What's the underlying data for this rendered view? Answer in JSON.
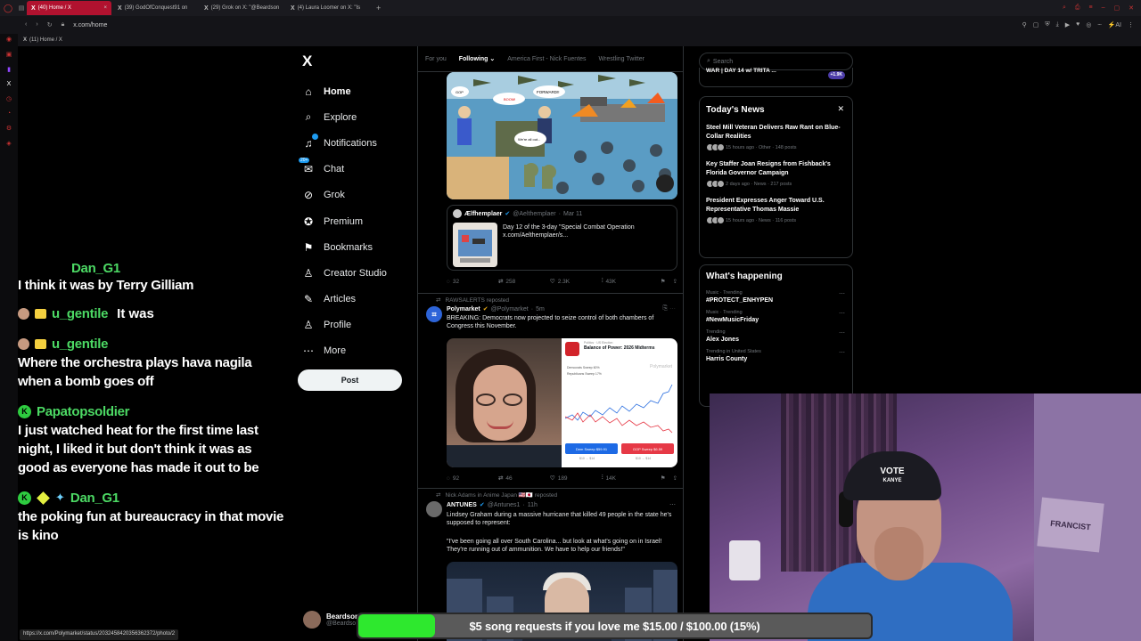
{
  "browser": {
    "tabs": [
      {
        "label": "(40) Home / X",
        "active": true
      },
      {
        "label": "(39) GodOfConquest91 on",
        "active": false
      },
      {
        "label": "(29) Grok on X: \"@Beardson",
        "active": false
      },
      {
        "label": "(4) Laura Loomer on X: \"Is",
        "active": false
      }
    ],
    "url": "x.com/home",
    "bookmark": "(11) Home / X",
    "status_url": "https://x.com/Polymarket/status/2032458420356362372/photo/2"
  },
  "chat": [
    {
      "user": "Dan_G1",
      "msg": "I think it was by Terry Gilliam",
      "cut": true
    },
    {
      "user": "u_gentile",
      "msg": "It was",
      "inline": true
    },
    {
      "user": "u_gentile",
      "msg": "Where the orchestra plays hava nagila when a bomb goes off"
    },
    {
      "user": "Papatopsoldier",
      "msg": "I just watched heat for the first time last night, I liked it but don't think it was as good as everyone has made it out to be"
    },
    {
      "user": "Dan_G1",
      "msg": "the poking fun at bureaucracy in that movie is kino"
    }
  ],
  "nav": {
    "logo": "X",
    "items": [
      {
        "label": "Home",
        "icon": "home-icon",
        "glyph": "⌂"
      },
      {
        "label": "Explore",
        "icon": "search-icon",
        "glyph": "⌕"
      },
      {
        "label": "Notifications",
        "icon": "bell-icon",
        "glyph": "♫"
      },
      {
        "label": "Chat",
        "icon": "chat-icon",
        "glyph": "✉"
      },
      {
        "label": "Grok",
        "icon": "grok-icon",
        "glyph": "⊘"
      },
      {
        "label": "Premium",
        "icon": "premium-icon",
        "glyph": "✪"
      },
      {
        "label": "Bookmarks",
        "icon": "bookmark-icon",
        "glyph": "⚑"
      },
      {
        "label": "Creator Studio",
        "icon": "creator-icon",
        "glyph": "♙"
      },
      {
        "label": "Articles",
        "icon": "articles-icon",
        "glyph": "✎"
      },
      {
        "label": "Profile",
        "icon": "profile-icon",
        "glyph": "♙"
      },
      {
        "label": "More",
        "icon": "more-icon",
        "glyph": "⋯"
      }
    ],
    "chat_badge": "20+",
    "post_label": "Post",
    "profile_name": "Beardson",
    "profile_handle": "@Beardso"
  },
  "timeline": {
    "tabs": [
      "For you",
      "Following",
      "America First - Nick Fuentes",
      "Wrestling Twitter"
    ],
    "active_tab": "Following",
    "post1": {
      "quote_name": "Ælfhemplaer",
      "quote_handle": "@Aelthemplaer",
      "quote_date": "Mar 11",
      "quote_text": "Day 12 of the 3-day \"Special Combat Operation x.com/Aelthemplaer/s...",
      "actions": {
        "replies": "32",
        "reposts": "258",
        "likes": "2.3K",
        "views": "43K"
      },
      "cartoon_bubbles": [
        "FORWARD!!",
        "We're all out...",
        "GOP",
        "BOOM!",
        "BOOM!"
      ]
    },
    "post2": {
      "repost_by": "RAWSALERTS reposted",
      "name": "Polymarket",
      "handle": "@Polymarket",
      "time": "5m",
      "text": "BREAKING: Democrats now projected to seize control of both chambers of Congress this November.",
      "chart_subtitle": "Politics · US Election",
      "chart_title": "Balance of Power: 2026 Midterms",
      "chart_watermark": "Polymarket",
      "legend_d": "Democrats Sweep 60%",
      "legend_r": "Republicans Sweep 17%",
      "btn_d": "Dem Sweep $59.91",
      "btn_r": "GOP Sweep $6.59",
      "sub_d": "$10 → $14",
      "sub_r": "$10 → $14",
      "actions": {
        "replies": "92",
        "reposts": "46",
        "likes": "189",
        "views": "14K"
      }
    },
    "post3": {
      "repost_by": "Nick Adams in Anime Japan 🇺🇸🇯🇵 reposted",
      "name": "ANTUNES",
      "handle": "@Antunes1",
      "time": "11h",
      "text1": "Lindsey Graham during a massive hurricane that killed 49 people in the state he's supposed to represent:",
      "text2": "\"I've been going all over South Carolina... but look at what's going on in Israel! They're running out of ammunition. We have to help our friends!\""
    }
  },
  "sidebar": {
    "search_placeholder": "Search",
    "top_trend": "WAR | DAY 14 w/ TRITA ...",
    "top_trend_count": "+1.9K",
    "news": {
      "title": "Today's News",
      "items": [
        {
          "title": "Steel Mill Veteran Delivers Raw Rant on Blue-Collar Realities",
          "meta": "15 hours ago · Other · 148 posts"
        },
        {
          "title": "Key Staffer Joan Resigns from Fishback's Florida Governor Campaign",
          "meta": "2 days ago · News · 217 posts"
        },
        {
          "title": "President Expresses Anger Toward U.S. Representative Thomas Massie",
          "meta": "15 hours ago · News · 116 posts"
        }
      ]
    },
    "happening": {
      "title": "What's happening",
      "items": [
        {
          "context": "Music · Trending",
          "name": "#PROTECT_ENHYPEN"
        },
        {
          "context": "Music · Trending",
          "name": "#NewMusicFriday"
        },
        {
          "context": "Trending",
          "name": "Alex Jones"
        },
        {
          "context": "Trending in United States",
          "name": "Harris County"
        }
      ]
    }
  },
  "webcam": {
    "cap_line1": "VOTE",
    "cap_line2": "KANYE",
    "poster": "FRANCIST"
  },
  "songbar": {
    "label": "$5 song requests if you love me $15.00 / $100.00 (15%)",
    "progress": 0.15,
    "fill_color": "#2ee82e"
  }
}
